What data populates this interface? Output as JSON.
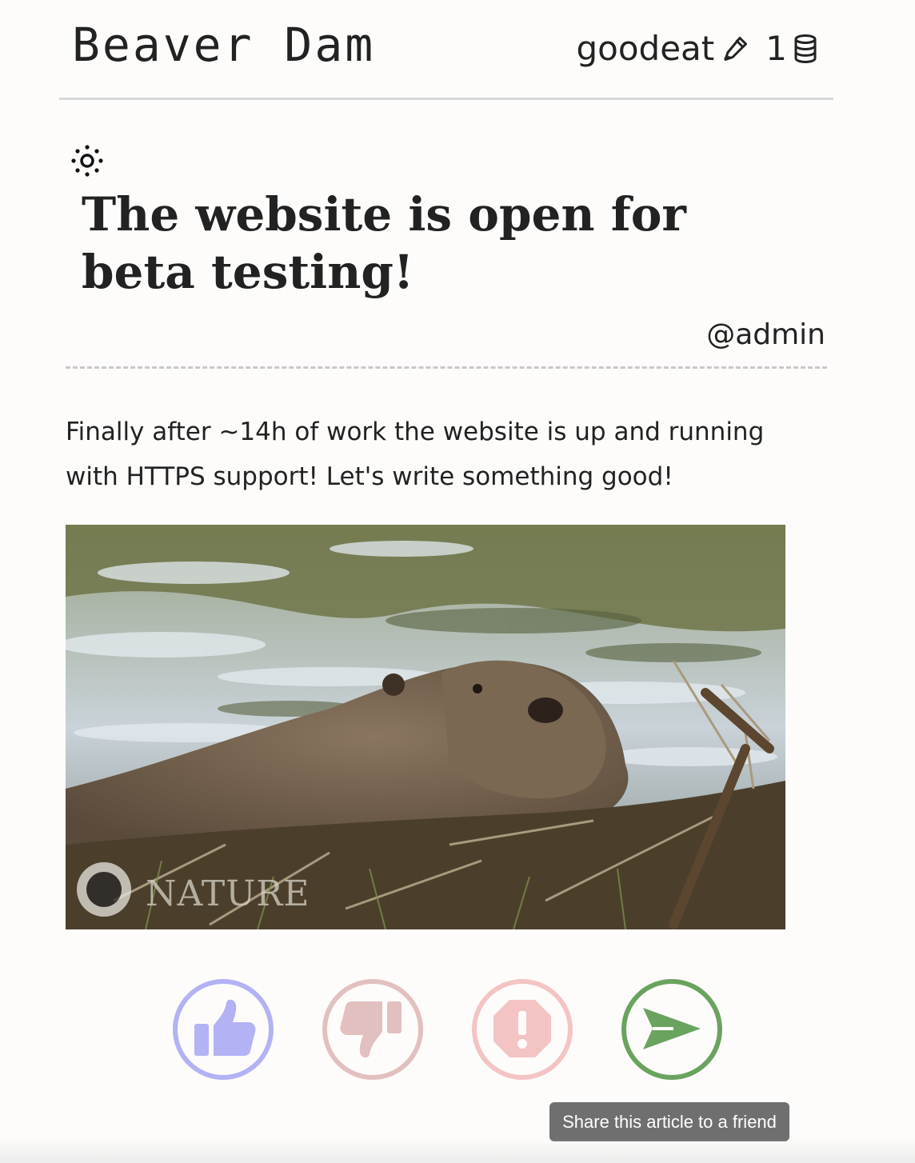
{
  "header": {
    "site_title": "Beaver Dam",
    "username": "goodeat",
    "coins": "1",
    "icons": {
      "edit": "pencil-icon",
      "coins": "coin-stack-icon"
    }
  },
  "theme_toggle_icon": "sun-icon",
  "article": {
    "title": "The website is open for beta testing!",
    "author": "@admin",
    "body": "Finally after ~14h of work the website is up and running with HTTPS support! Let's write something good!",
    "media": {
      "watermark": "NATURE"
    }
  },
  "actions": [
    {
      "name": "like",
      "icon": "thumbs-up-icon",
      "color": "#b3b2f5"
    },
    {
      "name": "dislike",
      "icon": "thumbs-down-icon",
      "color": "#e2c0c0"
    },
    {
      "name": "report",
      "icon": "alert-octagon-icon",
      "color": "#f4c4c4"
    },
    {
      "name": "share",
      "icon": "send-icon",
      "color": "#6aa35e"
    }
  ],
  "tooltip": "Share this article to a friend"
}
